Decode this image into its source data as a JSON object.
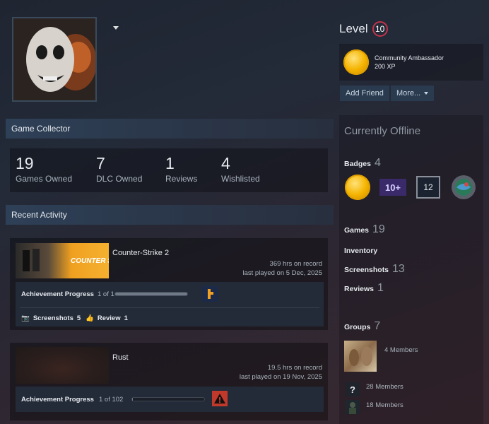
{
  "profile": {
    "level_label": "Level",
    "level": "10",
    "featured_badge": {
      "name": "Community Ambassador",
      "xp": "200 XP"
    },
    "buttons": {
      "add_friend": "Add Friend",
      "more": "More..."
    }
  },
  "collector": {
    "title": "Game Collector",
    "stats": [
      {
        "value": "19",
        "label": "Games Owned"
      },
      {
        "value": "7",
        "label": "DLC Owned"
      },
      {
        "value": "1",
        "label": "Reviews"
      },
      {
        "value": "4",
        "label": "Wishlisted"
      }
    ]
  },
  "activity": {
    "title": "Recent Activity",
    "games": [
      {
        "name": "Counter-Strike 2",
        "capsule_text": "COUNTER STRIKE",
        "hours": "369 hrs on record",
        "last_played": "last played on 5 Dec, 2025",
        "achievement_label": "Achievement Progress",
        "achievement_count": "1 of 1",
        "achievement_progress": 1.0,
        "screenshots_label": "Screenshots",
        "screenshots": "5",
        "review_label": "Review",
        "reviews": "1"
      },
      {
        "name": "Rust",
        "hours": "19.5 hrs on record",
        "last_played": "last played on 19 Nov, 2025",
        "achievement_label": "Achievement Progress",
        "achievement_count": "1 of 102",
        "achievement_progress": 0.01
      }
    ]
  },
  "sidebar": {
    "status": "Currently Offline",
    "badges": {
      "label": "Badges",
      "count": "4",
      "items": [
        "community-ambassador-badge",
        "years-of-service-badge",
        "level-12-badge",
        "planet-badge"
      ],
      "years_text": "10+",
      "level_text": "12"
    },
    "games": {
      "label": "Games",
      "count": "19"
    },
    "inventory": {
      "label": "Inventory"
    },
    "screenshots": {
      "label": "Screenshots",
      "count": "13"
    },
    "reviews": {
      "label": "Reviews",
      "count": "1"
    },
    "groups": {
      "label": "Groups",
      "count": "7",
      "items": [
        {
          "members": "4 Members"
        },
        {
          "members": "28 Members",
          "icon_text": "?"
        },
        {
          "members": "18 Members"
        }
      ]
    }
  },
  "colors": {
    "accent": "#c0344b",
    "panel_head": "#2e4057",
    "text": "#c7d5e0"
  }
}
